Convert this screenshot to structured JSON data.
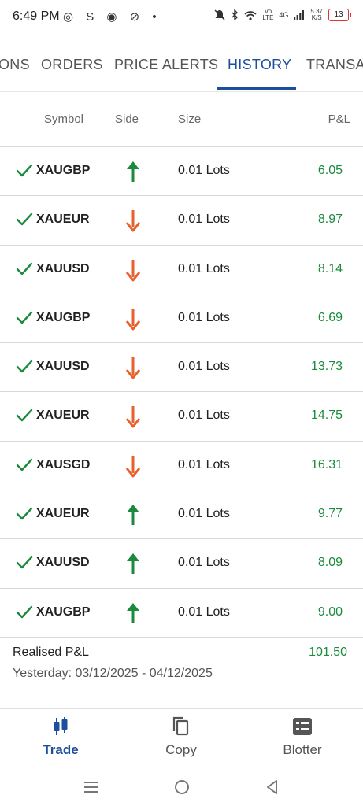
{
  "status_bar": {
    "time": "6:49 PM",
    "left_icons": "◎ S ◉ ⊘ •",
    "network_type": "4G",
    "volte_top": "Vo",
    "volte_bottom": "LTE",
    "speed_top": "5.37",
    "speed_bottom": "K/S",
    "battery": "13"
  },
  "tabs": {
    "items": [
      "ONS",
      "ORDERS",
      "PRICE ALERTS",
      "HISTORY",
      "TRANSAC"
    ],
    "active": "HISTORY",
    "accent": "#1e4f9c"
  },
  "table": {
    "headers": {
      "symbol": "Symbol",
      "side": "Side",
      "size": "Size",
      "pnl": "P&L"
    },
    "rows": [
      {
        "symbol": "XAUGBP",
        "side": "buy",
        "size": "0.01 Lots",
        "pnl": "6.05"
      },
      {
        "symbol": "XAUEUR",
        "side": "sell",
        "size": "0.01 Lots",
        "pnl": "8.97"
      },
      {
        "symbol": "XAUUSD",
        "side": "sell",
        "size": "0.01 Lots",
        "pnl": "8.14"
      },
      {
        "symbol": "XAUGBP",
        "side": "sell",
        "size": "0.01 Lots",
        "pnl": "6.69"
      },
      {
        "symbol": "XAUUSD",
        "side": "sell",
        "size": "0.01 Lots",
        "pnl": "13.73"
      },
      {
        "symbol": "XAUEUR",
        "side": "sell",
        "size": "0.01 Lots",
        "pnl": "14.75"
      },
      {
        "symbol": "XAUSGD",
        "side": "sell",
        "size": "0.01 Lots",
        "pnl": "16.31"
      },
      {
        "symbol": "XAUEUR",
        "side": "buy",
        "size": "0.01 Lots",
        "pnl": "9.77"
      },
      {
        "symbol": "XAUUSD",
        "side": "buy",
        "size": "0.01 Lots",
        "pnl": "8.09"
      },
      {
        "symbol": "XAUGBP",
        "side": "buy",
        "size": "0.01 Lots",
        "pnl": "9.00"
      }
    ],
    "colors": {
      "buy": "#1a8a3c",
      "sell": "#e8602c",
      "pnl": "#1a8a3c",
      "check": "#1a8a3c"
    }
  },
  "summary": {
    "label": "Realised P&L",
    "value": "101.50",
    "range": "Yesterday: 03/12/2025 - 04/12/2025"
  },
  "bottom_nav": {
    "items": [
      {
        "label": "Trade",
        "icon": "candlestick-icon",
        "active": true
      },
      {
        "label": "Copy",
        "icon": "copy-icon",
        "active": false
      },
      {
        "label": "Blotter",
        "icon": "blotter-icon",
        "active": false
      }
    ]
  },
  "system_nav": {
    "icons": [
      "menu-icon",
      "home-icon",
      "back-icon"
    ]
  }
}
